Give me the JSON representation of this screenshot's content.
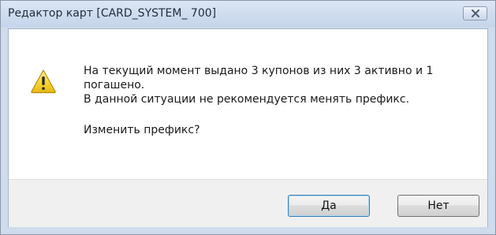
{
  "window": {
    "title": "Редактор карт [CARD_SYSTEM_ 700]"
  },
  "icons": {
    "close": "close-icon",
    "warning": "warning-icon"
  },
  "message": {
    "line1": "На текущий момент выдано 3 купонов из них 3 активно и 1 погашено.",
    "line2": "В данной ситуации не рекомендуется менять префикс.",
    "question": "Изменить префикс?"
  },
  "buttons": {
    "yes": "Да",
    "no": "Нет"
  },
  "colors": {
    "titlebar": "#cddbee",
    "warning_fill": "#f5d22e",
    "default_button_border": "#3c7fb1"
  }
}
